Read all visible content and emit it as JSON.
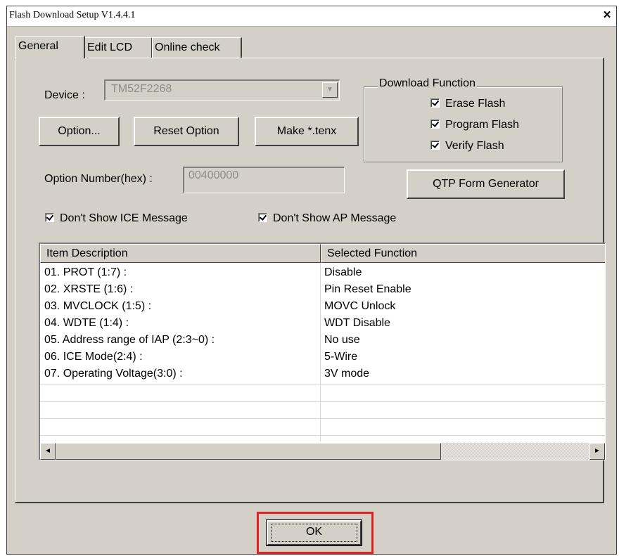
{
  "window": {
    "title": "Flash Download Setup V1.4.4.1",
    "close_glyph": "×"
  },
  "tabs": [
    {
      "label": "General",
      "active": true
    },
    {
      "label": "Edit LCD",
      "active": false
    },
    {
      "label": "Online check",
      "active": false
    }
  ],
  "device": {
    "label": "Device :",
    "value": "TM52F2268",
    "dropdown_icon": "chevron-down-icon"
  },
  "buttons": {
    "option": "Option...",
    "reset_option": "Reset Option",
    "make_tenx": "Make *.tenx",
    "qtp": "QTP Form Generator",
    "ok": "OK"
  },
  "download_function": {
    "title": "Download Function",
    "items": [
      {
        "label": "Erase Flash",
        "checked": true
      },
      {
        "label": "Program Flash",
        "checked": true
      },
      {
        "label": "Verify Flash",
        "checked": true
      }
    ]
  },
  "option_number": {
    "label": "Option Number(hex) :",
    "value": "00400000"
  },
  "checks": {
    "ice_message": {
      "label": "Don't Show ICE Message",
      "checked": true
    },
    "ap_message": {
      "label": "Don't Show AP Message",
      "checked": true
    }
  },
  "table": {
    "columns": [
      "Item Description",
      "Selected Function"
    ],
    "rows": [
      [
        "01. PROT (1:7) :",
        "Disable"
      ],
      [
        "02. XRSTE (1:6) :",
        "Pin Reset Enable"
      ],
      [
        "03. MVCLOCK (1:5) :",
        "MOVC Unlock"
      ],
      [
        "04. WDTE (1:4) :",
        "WDT Disable"
      ],
      [
        "05. Address range of IAP (2:3~0)  :",
        "No use"
      ],
      [
        "06. ICE Mode(2:4) :",
        "5-Wire"
      ],
      [
        "07. Operating Voltage(3:0) :",
        "3V mode"
      ]
    ],
    "scroll_left_icon": "◄",
    "scroll_right_icon": "►"
  },
  "colors": {
    "highlight": "#e32222",
    "face": "#d4d0c8"
  }
}
